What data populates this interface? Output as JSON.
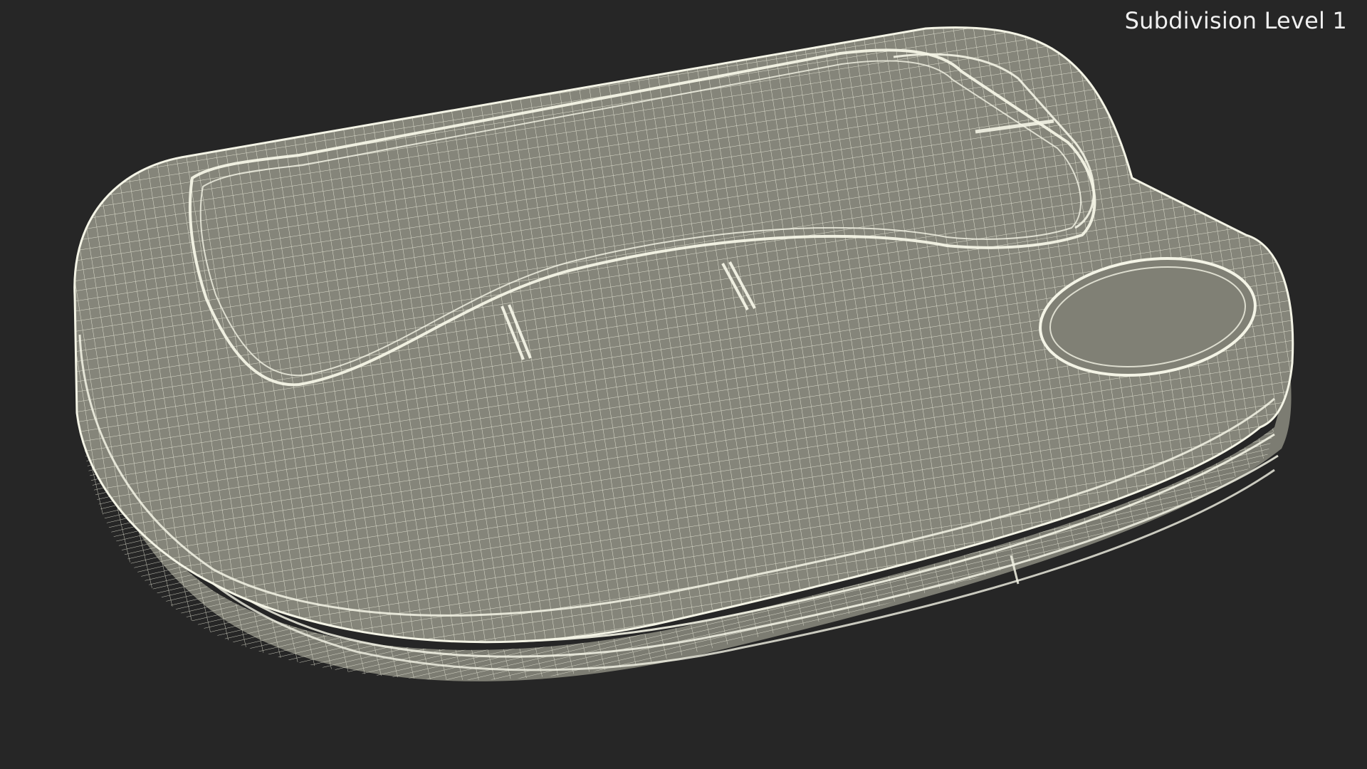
{
  "viewport": {
    "label": "Subdivision Level 1",
    "background_color": "#262626",
    "label_color": "#f0f0f0"
  },
  "model": {
    "icon": "wireframe-case-mesh",
    "surface_color": "#85857a",
    "wire_color": "#eeeedd"
  }
}
